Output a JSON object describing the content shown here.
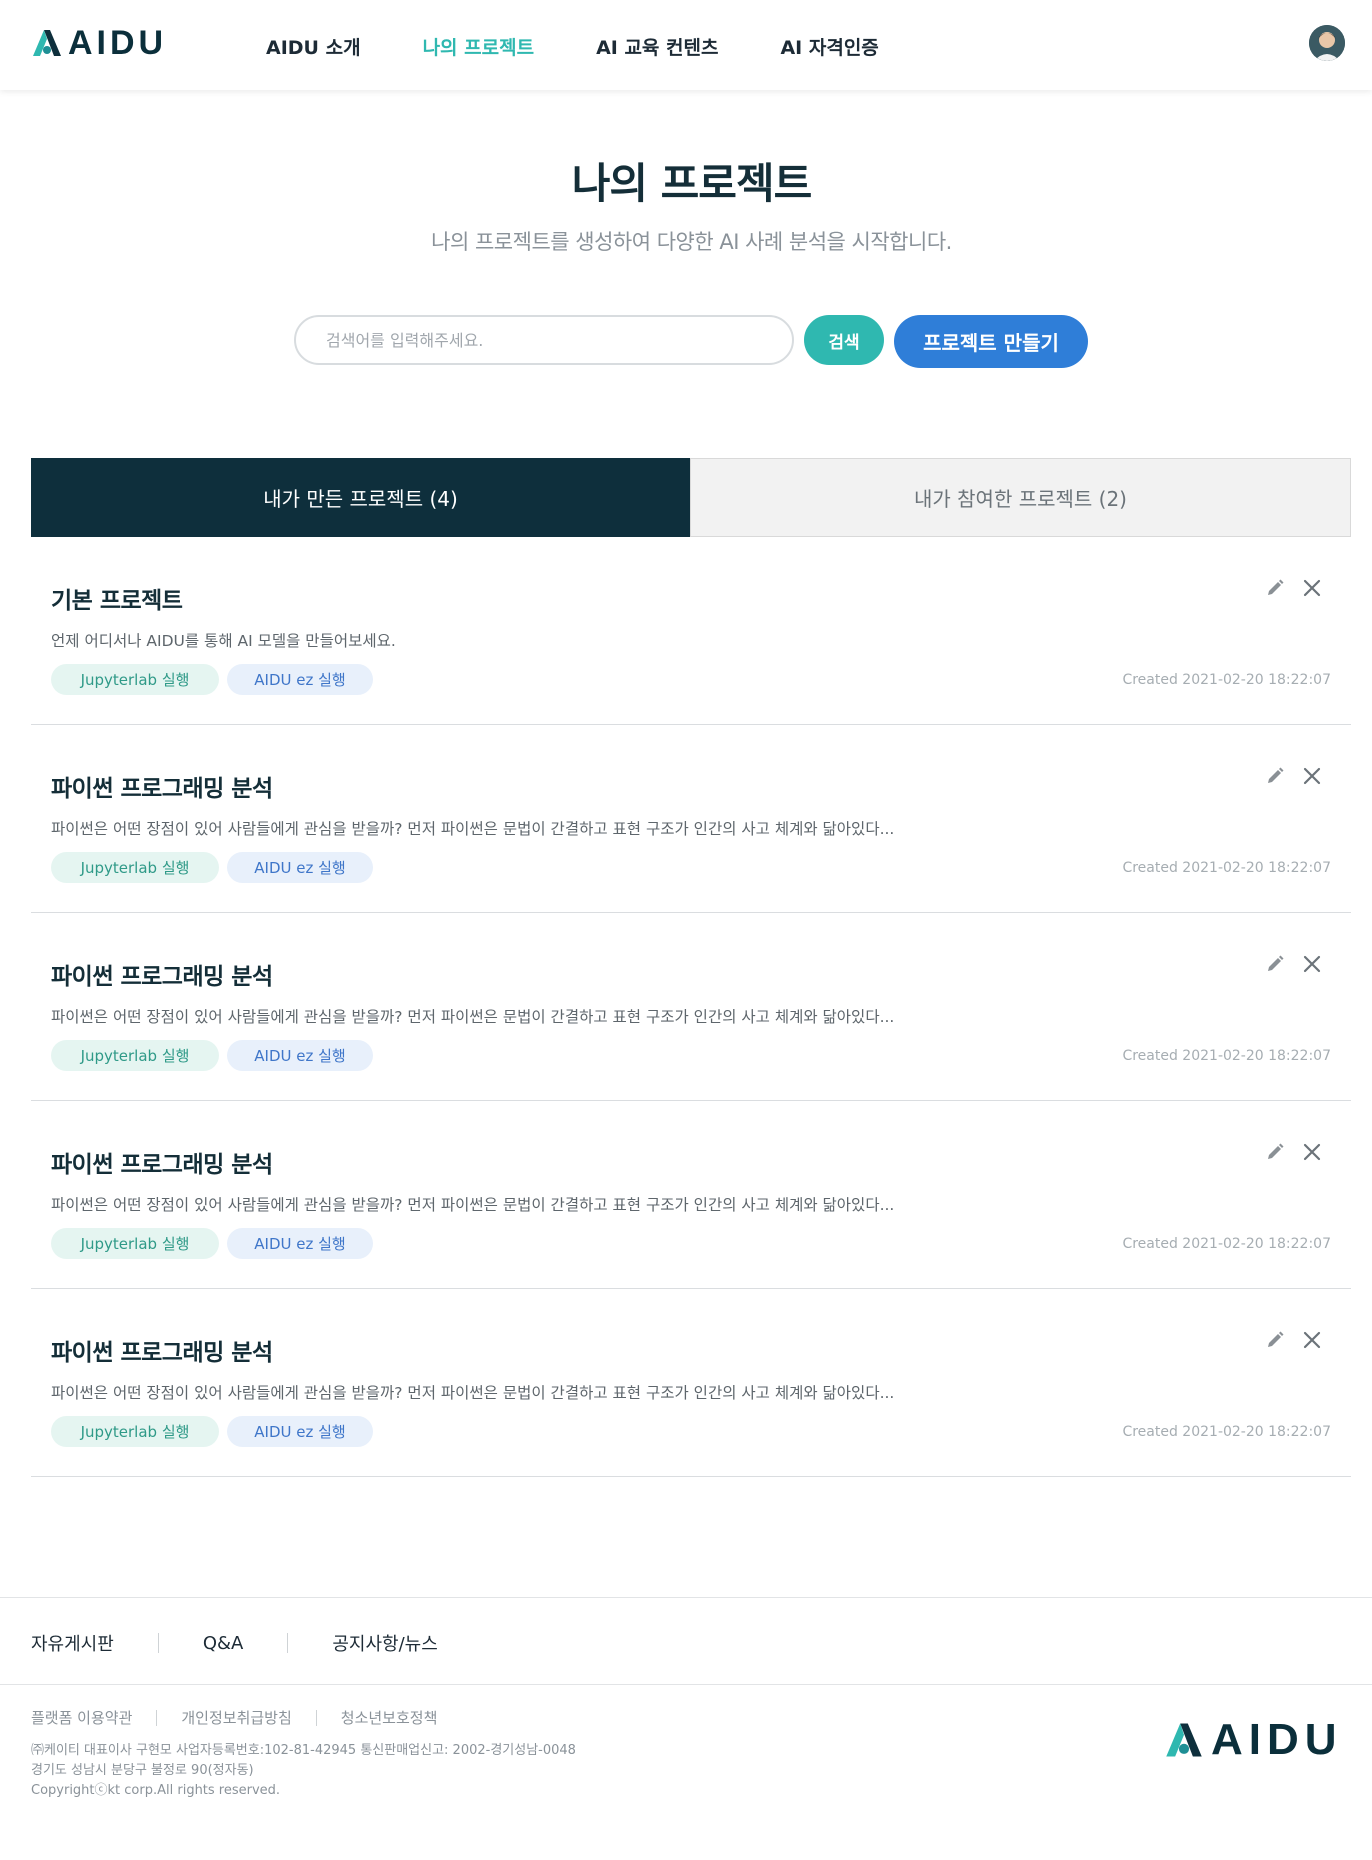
{
  "header": {
    "logo_text": "AIDU",
    "nav": [
      {
        "label": "AIDU 소개",
        "active": false
      },
      {
        "label": "나의 프로젝트",
        "active": true
      },
      {
        "label": "AI 교육 컨텐츠",
        "active": false
      },
      {
        "label": "AI 자격인증",
        "active": false
      }
    ]
  },
  "hero": {
    "title": "나의 프로젝트",
    "subtitle": "나의 프로젝트를 생성하여 다양한 AI 사례 분석을 시작합니다."
  },
  "search": {
    "placeholder": "검색어를 입력해주세요.",
    "value": "",
    "search_label": "검색",
    "create_label": "프로젝트 만들기"
  },
  "tabs": [
    {
      "label": "내가 만든 프로젝트 (4)",
      "active": true
    },
    {
      "label": "내가 참여한 프로젝트 (2)",
      "active": false
    }
  ],
  "projects": [
    {
      "title": "기본 프로젝트",
      "description": "언제 어디서나 AIDU를 통해 AI 모델을 만들어보세요.",
      "tag_jupyter": "Jupyterlab 실행",
      "tag_aidu": "AIDU ez 실행",
      "created": "Created 2021-02-20 18:22:07"
    },
    {
      "title": "파이썬 프로그래밍 분석",
      "description": "파이썬은 어떤 장점이 있어 사람들에게 관심을 받을까? 먼저 파이썬은 문법이 간결하고 표현 구조가 인간의 사고 체계와 닮아있다...",
      "tag_jupyter": "Jupyterlab 실행",
      "tag_aidu": "AIDU ez 실행",
      "created": "Created 2021-02-20 18:22:07"
    },
    {
      "title": "파이썬 프로그래밍 분석",
      "description": "파이썬은 어떤 장점이 있어 사람들에게 관심을 받을까? 먼저 파이썬은 문법이 간결하고 표현 구조가 인간의 사고 체계와 닮아있다...",
      "tag_jupyter": "Jupyterlab 실행",
      "tag_aidu": "AIDU ez 실행",
      "created": "Created 2021-02-20 18:22:07"
    },
    {
      "title": "파이썬 프로그래밍 분석",
      "description": "파이썬은 어떤 장점이 있어 사람들에게 관심을 받을까? 먼저 파이썬은 문법이 간결하고 표현 구조가 인간의 사고 체계와 닮아있다...",
      "tag_jupyter": "Jupyterlab 실행",
      "tag_aidu": "AIDU ez 실행",
      "created": "Created 2021-02-20 18:22:07"
    },
    {
      "title": "파이썬 프로그래밍 분석",
      "description": "파이썬은 어떤 장점이 있어 사람들에게 관심을 받을까? 먼저 파이썬은 문법이 간결하고 표현 구조가 인간의 사고 체계와 닮아있다...",
      "tag_jupyter": "Jupyterlab 실행",
      "tag_aidu": "AIDU ez 실행",
      "created": "Created 2021-02-20 18:22:07"
    }
  ],
  "footer": {
    "links": [
      "자유게시판",
      "Q&A",
      "공지사항/뉴스"
    ],
    "legal_links": [
      "플랫폼 이용약관",
      "개인정보취급방침",
      "청소년보호정책"
    ],
    "company_lines": [
      "㈜케이티 대표이사 구현모 사업자등록번호:102-81-42945 통신판매업신고: 2002-경기성남-0048",
      "경기도 성남시 분당구 불정로 90(정자동)",
      "Copyrightⓒkt corp.All rights reserved."
    ],
    "logo_text": "AIDU"
  },
  "colors": {
    "brand_dark": "#0e2f3c",
    "accent_teal": "#2fb8b0",
    "accent_blue": "#2f7ed8"
  },
  "icons": {
    "edit": "pencil-icon",
    "delete": "close-icon",
    "logo": "aidu-logo-mark"
  }
}
